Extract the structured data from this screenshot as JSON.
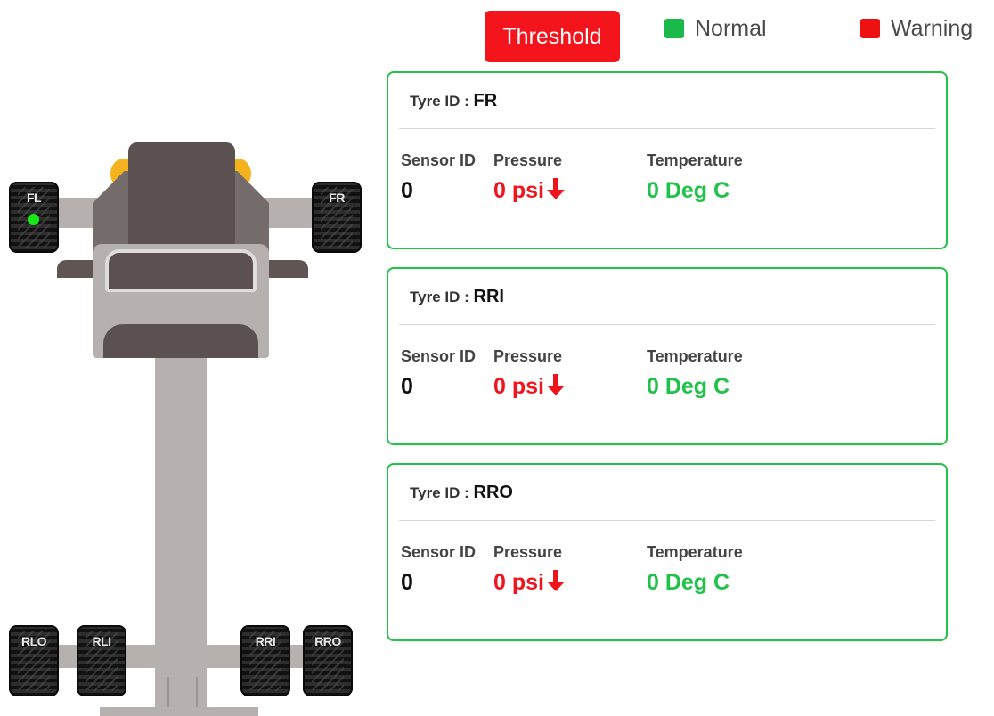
{
  "header": {
    "threshold_label": "Threshold",
    "legend": [
      {
        "label": "Normal",
        "color": "#1bb84a"
      },
      {
        "label": "Warning",
        "color": "#ee1111"
      }
    ]
  },
  "vehicle": {
    "tyres": [
      {
        "id": "FL",
        "has_indicator": true,
        "indicator_color": "#18e818"
      },
      {
        "id": "FR",
        "has_indicator": false
      },
      {
        "id": "RLO",
        "has_indicator": false
      },
      {
        "id": "RLI",
        "has_indicator": false
      },
      {
        "id": "RRI",
        "has_indicator": false
      },
      {
        "id": "RRO",
        "has_indicator": false
      }
    ]
  },
  "cards": [
    {
      "tyre_id_label": "Tyre ID :",
      "tyre_id": "FR",
      "sensor_label": "Sensor ID",
      "sensor_value": "0",
      "pressure_label": "Pressure",
      "pressure_value": "0 psi",
      "pressure_trend": "down-arrow-icon",
      "temperature_label": "Temperature",
      "temperature_value": "0 Deg C"
    },
    {
      "tyre_id_label": "Tyre ID :",
      "tyre_id": "RRI",
      "sensor_label": "Sensor ID",
      "sensor_value": "0",
      "pressure_label": "Pressure",
      "pressure_value": "0 psi",
      "pressure_trend": "down-arrow-icon",
      "temperature_label": "Temperature",
      "temperature_value": "0 Deg C"
    },
    {
      "tyre_id_label": "Tyre ID :",
      "tyre_id": "RRO",
      "sensor_label": "Sensor ID",
      "sensor_value": "0",
      "pressure_label": "Pressure",
      "pressure_value": "0 psi",
      "pressure_trend": "down-arrow-icon",
      "temperature_label": "Temperature",
      "temperature_value": "0 Deg C"
    }
  ],
  "colors": {
    "card_border": "#24c24a",
    "pressure": "#f0141c",
    "temperature": "#20c24a",
    "threshold_button": "#f4141c"
  }
}
